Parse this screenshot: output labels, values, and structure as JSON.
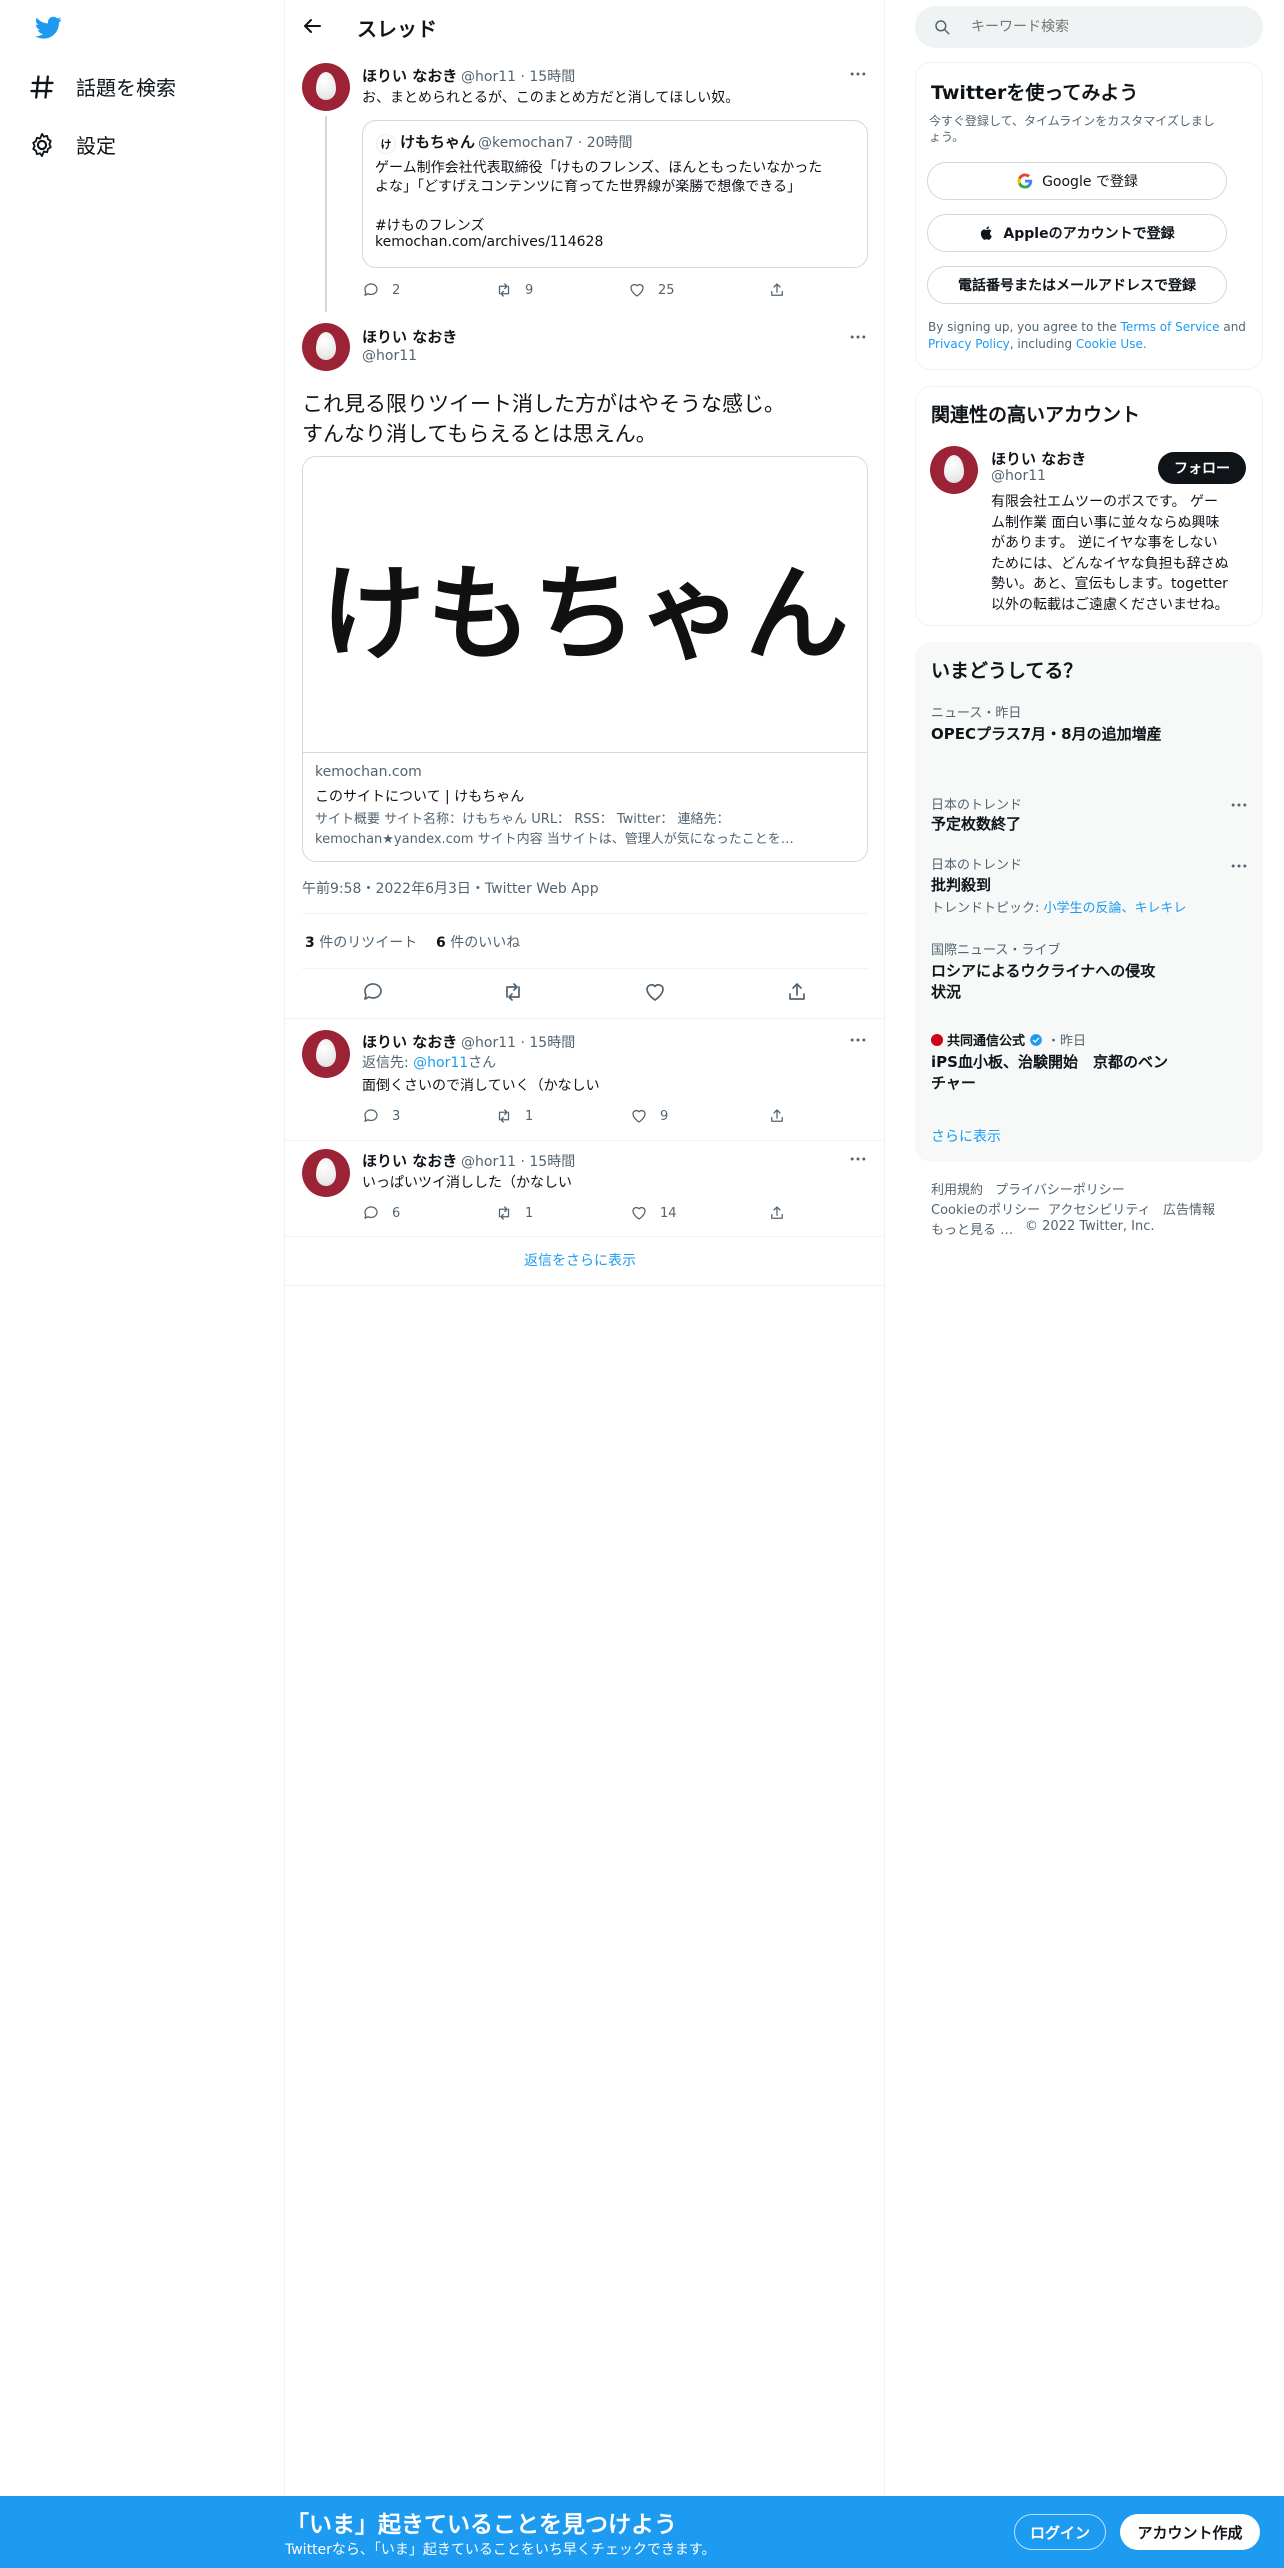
{
  "nav": {
    "explore_label": "話題を検索",
    "settings_label": "設定"
  },
  "header": {
    "title": "スレッド"
  },
  "tweet1": {
    "name": "ほりい なおき",
    "handle": "@hor11",
    "time": "15時間",
    "text": "お、まとめられとるが、このまとめ方だと消してほしい奴。",
    "quote": {
      "icon_text": "け",
      "name": "けもちゃん",
      "handle": "@kemochan7",
      "time": "20時間",
      "line1": "ゲーム制作会社代表取締役「けものフレンズ、ほんともったいなかった",
      "line2": "よな」「どすげえコンテンツに育ってた世界線が楽勝で想像できる」",
      "hashtag": "#けものフレンズ",
      "link": "kemochan.com/archives/114628"
    },
    "replies": "2",
    "retweets": "9",
    "likes": "25"
  },
  "main_tweet": {
    "name": "ほりい なおき",
    "handle": "@hor11",
    "text_line1": "これ見る限りツイート消した方がはやそうな感じ。",
    "text_line2": "すんなり消してもらえるとは思えん。",
    "card": {
      "image_text": "けもちゃん",
      "domain": "kemochan.com",
      "title": "このサイトについて | けもちゃん",
      "desc_line1": "サイト概要 サイト名称：けもちゃん URL： RSS： Twitter： 連絡先：",
      "desc_line2": "kemochan★yandex.com サイト内容 当サイトは、管理人が気になったことを…"
    },
    "timestamp": "午前9:58・2022年6月3日・Twitter Web App",
    "retweet_count": "3",
    "retweet_label": "件のリツイート",
    "like_count": "6",
    "like_label": "件のいいね"
  },
  "reply1": {
    "name": "ほりい なおき",
    "handle": "@hor11",
    "time": "15時間",
    "reply_to_prefix": "返信先: ",
    "reply_to_handle": "@hor11",
    "reply_to_suffix": "さん",
    "text": "面倒くさいので消していく（かなしい",
    "replies": "3",
    "retweets": "1",
    "likes": "9"
  },
  "reply2": {
    "name": "ほりい なおき",
    "handle": "@hor11",
    "time": "15時間",
    "text": "いっぱいツイ消しした（かなしい",
    "replies": "6",
    "retweets": "1",
    "likes": "14"
  },
  "show_more_replies": "返信をさらに表示",
  "search": {
    "placeholder": "キーワード検索"
  },
  "signup_panel": {
    "title": "Twitterを使ってみよう",
    "subtitle_line1": "今すぐ登録して、タイムラインをカスタマイズしまし",
    "subtitle_line2": "ょう。",
    "google_label": "Google で登録",
    "apple_label": "Appleのアカウントで登録",
    "phone_label": "電話番号またはメールアドレスで登録",
    "terms_prefix": "By signing up, you agree to the ",
    "terms_link": "Terms of Service",
    "terms_and": " and",
    "privacy_link": "Privacy Policy",
    "terms_including": ", including ",
    "cookie_link": "Cookie Use."
  },
  "relevant": {
    "title": "関連性の高いアカウント",
    "name": "ほりい なおき",
    "handle": "@hor11",
    "follow_label": "フォロー",
    "bio": [
      "有限会社エムツーのボスです。 ゲー",
      "ム制作業 面白い事に並々ならぬ興味",
      "があります。 逆にイヤな事をしない",
      "ためには、どんなイヤな負担も辞さぬ",
      "勢い。あと、宣伝もします。togetter",
      "以外の転載はご遠慮くださいませね。"
    ]
  },
  "trends": {
    "title": "いまどうしてる？",
    "items": [
      {
        "category": "ニュース・昨日",
        "title": "OPECプラス7月・8月の追加増産"
      },
      {
        "category": "日本のトレンド",
        "title": "予定枚数終了"
      },
      {
        "category": "日本のトレンド",
        "title": "批判殺到",
        "topic_prefix": "トレンドトピック: ",
        "topic_links": "小学生の反論、キレキレ"
      },
      {
        "category": "国際ニュース・ライブ",
        "title_line1": "ロシアによるウクライナへの侵攻",
        "title_line2": "状況"
      },
      {
        "source": "共同通信公式",
        "time": "・昨日",
        "title_line1": "iPS血小板、治験開始　京都のベン",
        "title_line2": "チャー"
      }
    ],
    "show_more": "さらに表示"
  },
  "footer": {
    "terms": "利用規約",
    "privacy": "プライバシーポリシー",
    "cookie": "Cookieのポリシー",
    "accessibility": "アクセシビリティ",
    "ads": "広告情報",
    "more": "もっと見る …",
    "copyright": "© 2022 Twitter, Inc."
  },
  "bottom_bar": {
    "title": "「いま」起きていることを見つけよう",
    "subtitle": "Twitterなら、「いま」起きていることをいち早くチェックできます。",
    "login_label": "ログイン",
    "signup_label": "アカウント作成"
  },
  "colors": {
    "accent": "#1d9bf0",
    "avatar_bg": "#9b2335",
    "text": "#0f1419",
    "muted": "#536471"
  }
}
